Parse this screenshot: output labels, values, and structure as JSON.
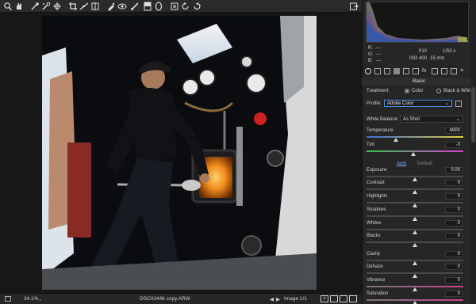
{
  "toolbar": {
    "tools": [
      "zoom-tool",
      "hand-tool",
      "white-balance-tool",
      "color-sampler-tool",
      "targeted-adjustment-tool",
      "crop-tool",
      "straighten-tool",
      "transform-tool",
      "spot-removal-tool",
      "red-eye-tool",
      "adjustment-brush-tool",
      "graduated-filter-tool",
      "radial-filter-tool",
      "rotate-left-tool",
      "rotate-right-tool"
    ],
    "open_panel_icon": "export-icon"
  },
  "histogram": {
    "r_label": "R:",
    "g_label": "G:",
    "b_label": "B:",
    "r_value": "---",
    "g_value": "---",
    "b_value": "---",
    "aperture": "f/10",
    "shutter": "1/50 s",
    "iso": "ISO 400",
    "focal": "15 mm"
  },
  "panel": {
    "section": "Basic",
    "treatment_label": "Treatment:",
    "treatment_color": "Color",
    "treatment_bw": "Black & White",
    "profile_label": "Profile:",
    "profile_value": "Adobe Color",
    "wb_label": "White Balance:",
    "wb_value": "As Shot",
    "auto_label": "Auto",
    "default_label": "Default",
    "sliders": [
      {
        "label": "Temperature",
        "value": "4900",
        "pos": 0.3
      },
      {
        "label": "Tint",
        "value": "-3",
        "pos": 0.48
      },
      {
        "label": "Exposure",
        "value": "0.00",
        "pos": 0.5
      },
      {
        "label": "Contrast",
        "value": "0",
        "pos": 0.5
      },
      {
        "label": "Highlights",
        "value": "0",
        "pos": 0.5
      },
      {
        "label": "Shadows",
        "value": "0",
        "pos": 0.5
      },
      {
        "label": "Whites",
        "value": "0",
        "pos": 0.5
      },
      {
        "label": "Blacks",
        "value": "0",
        "pos": 0.5
      },
      {
        "label": "Clarity",
        "value": "0",
        "pos": 0.5
      },
      {
        "label": "Dehaze",
        "value": "0",
        "pos": 0.5
      },
      {
        "label": "Vibrance",
        "value": "0",
        "pos": 0.5
      },
      {
        "label": "Saturation",
        "value": "0",
        "pos": 0.5
      }
    ]
  },
  "status": {
    "zoom": "34.1%",
    "filename": "DSC03446 copy.ARW",
    "image_count": "Image 1/1"
  },
  "colors": {
    "accent": "#4a90e2",
    "background": "#1f1f1f",
    "panel": "#262626"
  }
}
